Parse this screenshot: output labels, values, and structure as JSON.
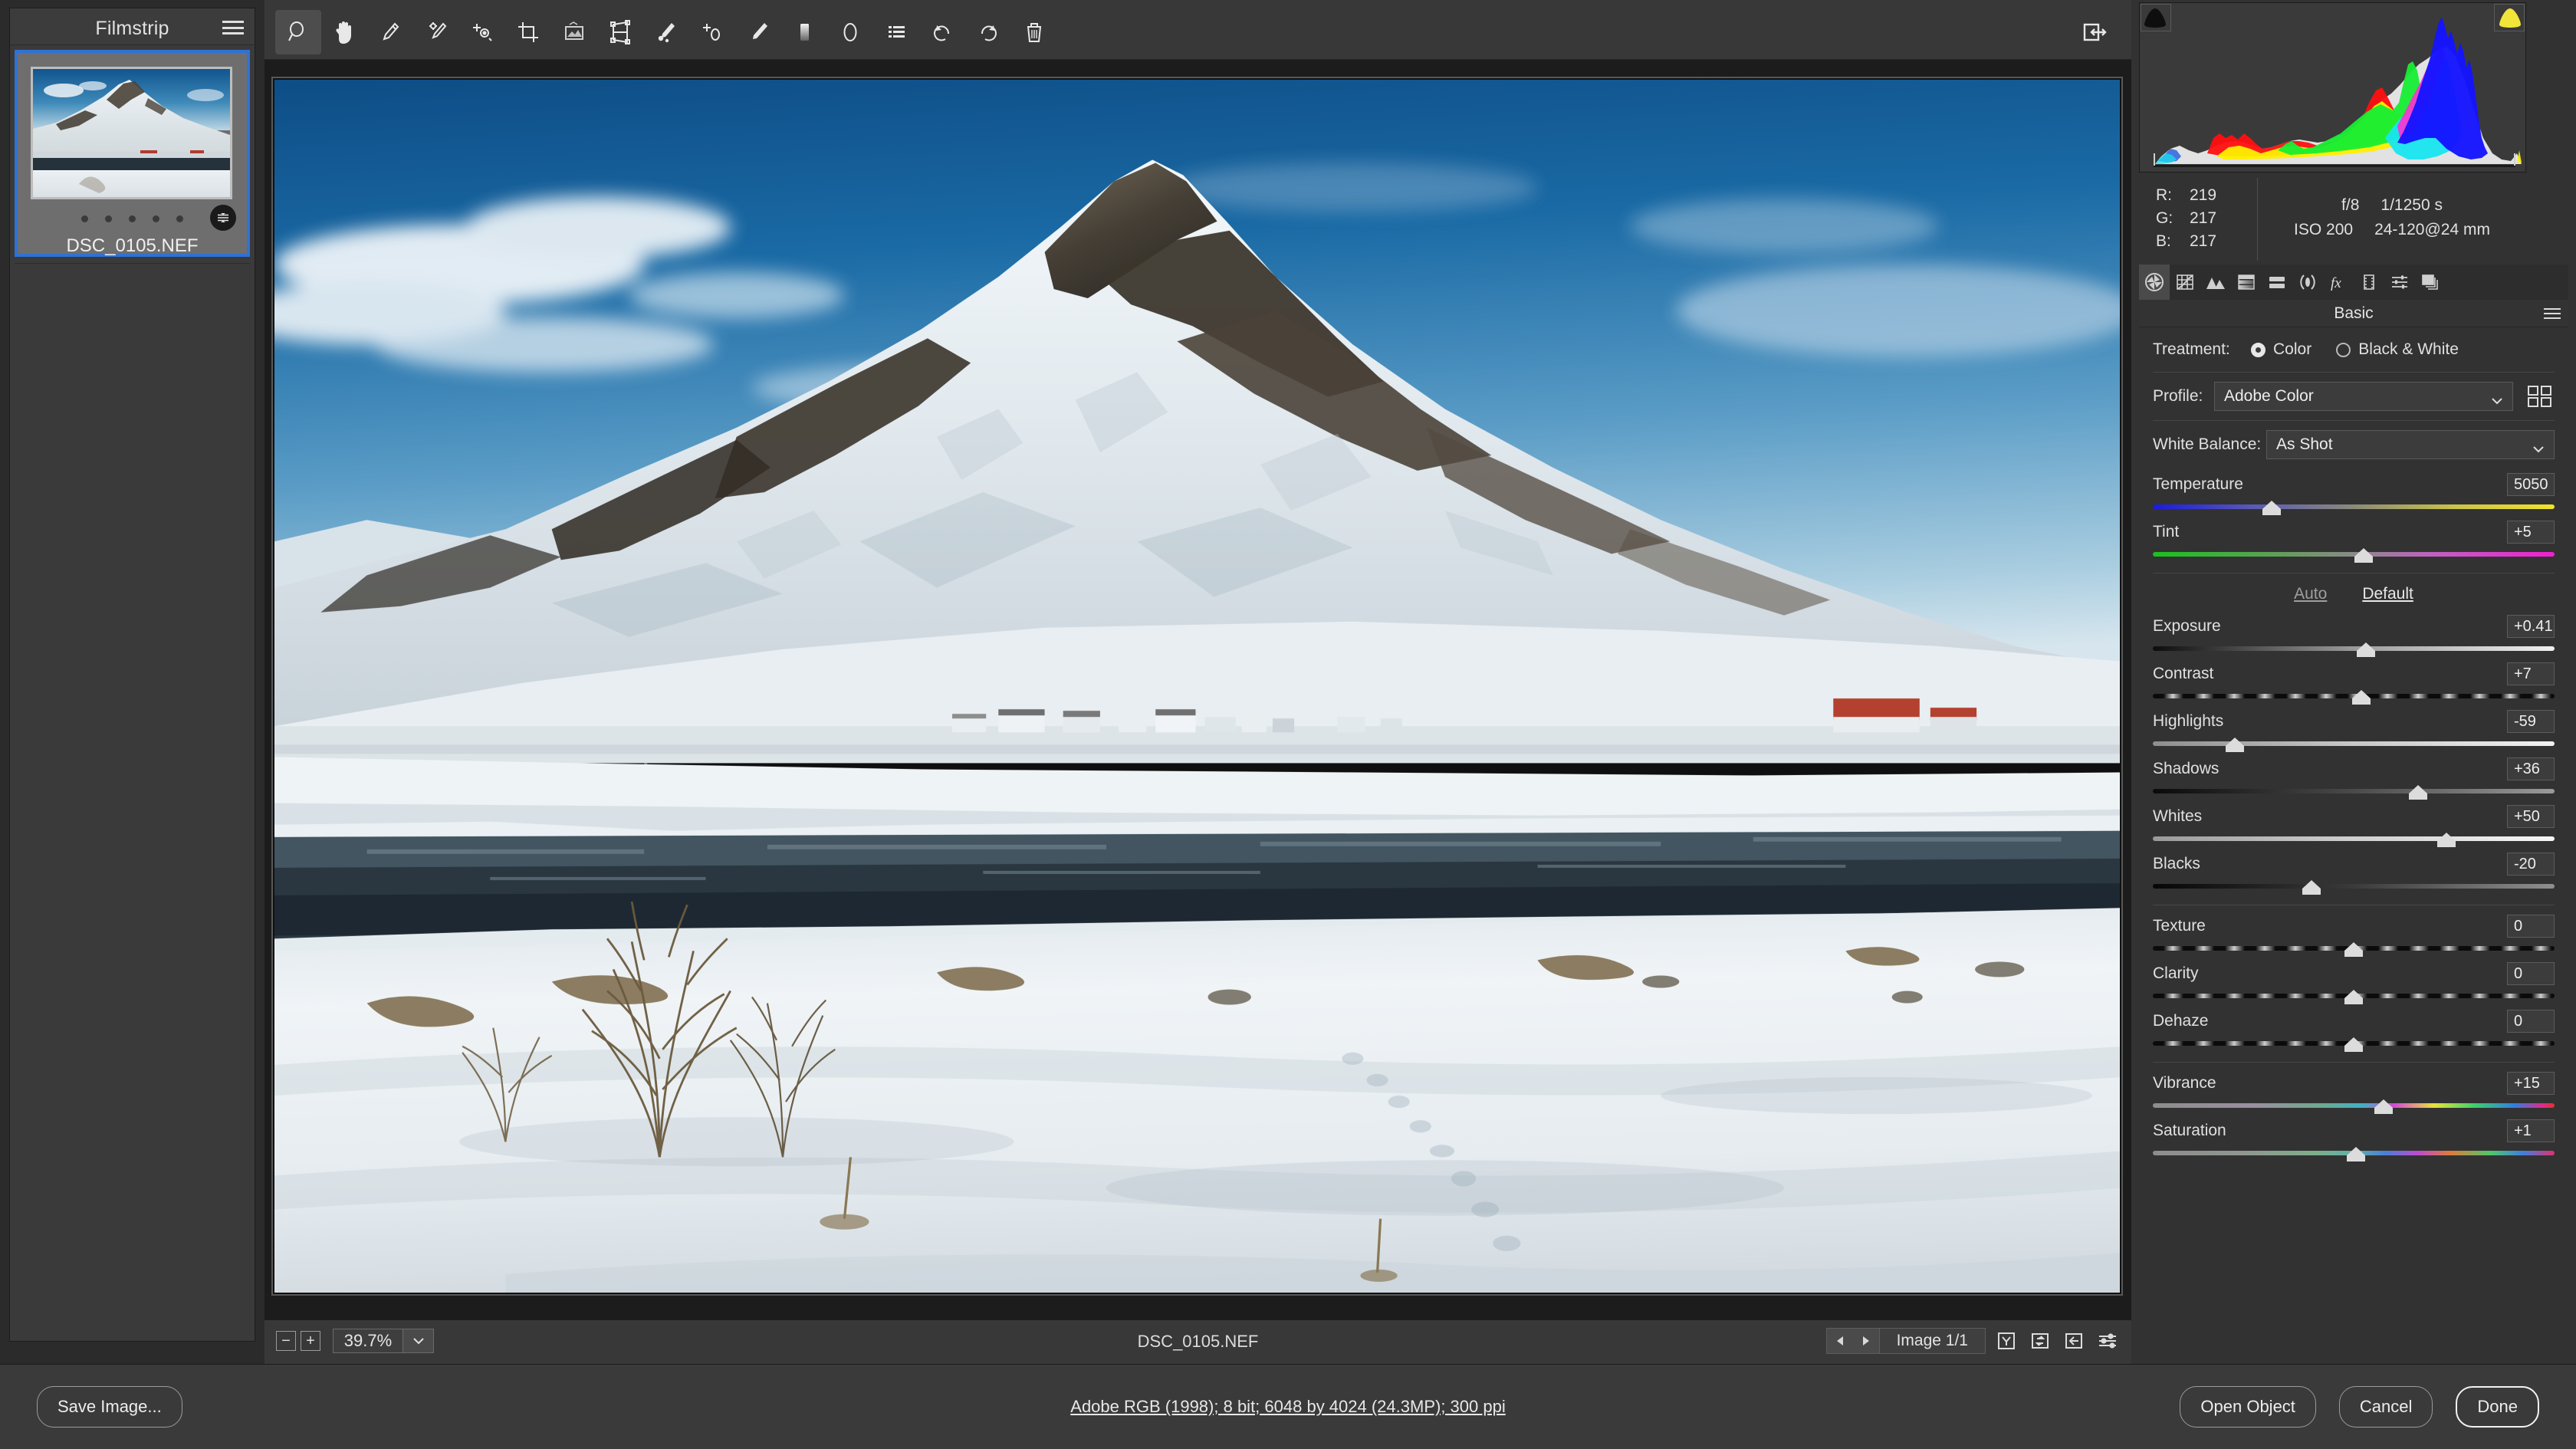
{
  "filmstrip": {
    "title": "Filmstrip",
    "menu_icon": "hamburger-icon",
    "thumbnail": {
      "filename": "DSC_0105.NEF",
      "selected": true,
      "rating_dots": 5,
      "badge_icon": "adjustments-badge-icon"
    }
  },
  "toolbar": {
    "tools": [
      {
        "name": "zoom-tool",
        "icon": "magnifier-icon",
        "active": true
      },
      {
        "name": "hand-tool",
        "icon": "hand-icon",
        "active": false
      },
      {
        "name": "white-balance-tool",
        "icon": "eyedropper-icon",
        "active": false
      },
      {
        "name": "color-sampler-tool",
        "icon": "color-sampler-icon",
        "active": false
      },
      {
        "name": "targeted-adjustment-tool",
        "icon": "target-adjust-icon",
        "active": false
      },
      {
        "name": "crop-tool",
        "icon": "crop-icon",
        "active": false
      },
      {
        "name": "straighten-tool",
        "icon": "straighten-icon",
        "active": false
      },
      {
        "name": "transform-tool",
        "icon": "transform-icon",
        "active": false
      },
      {
        "name": "spot-removal-tool",
        "icon": "spot-heal-icon",
        "active": false
      },
      {
        "name": "red-eye-tool",
        "icon": "red-eye-icon",
        "active": false
      },
      {
        "name": "adjustment-brush-tool",
        "icon": "brush-icon",
        "active": false
      },
      {
        "name": "graduated-filter-tool",
        "icon": "graduated-filter-icon",
        "active": false
      },
      {
        "name": "radial-filter-tool",
        "icon": "radial-filter-icon",
        "active": false
      },
      {
        "name": "presets-tool",
        "icon": "presets-list-icon",
        "active": false
      },
      {
        "name": "rotate-left-tool",
        "icon": "rotate-ccw-icon",
        "active": false
      },
      {
        "name": "rotate-right-tool",
        "icon": "rotate-cw-icon",
        "active": false
      },
      {
        "name": "delete-tool",
        "icon": "trash-icon",
        "active": false
      }
    ],
    "toggle_fullscreen_icon": "toggle-panel-icon"
  },
  "canvas": {
    "filename": "DSC_0105.NEF",
    "zoom": "39.7%",
    "zoom_out_label": "−",
    "zoom_in_label": "+",
    "zoom_caret_icon": "chevron-down-icon",
    "prev_icon": "triangle-left-icon",
    "next_icon": "triangle-right-icon",
    "image_count": "Image 1/1",
    "footer_icons": [
      "y-shape-icon",
      "swap-arrows-icon",
      "arrow-into-box-icon",
      "sliders-icon"
    ]
  },
  "histogram": {
    "shadow_clip_icon": "shadow-clip-triangle",
    "highlight_clip_icon": "highlight-clip-triangle",
    "highlight_clip_color": "#f2e53a",
    "shadow_clip_color": "#0e0e0e"
  },
  "readout": {
    "r_label": "R:",
    "r_value": "219",
    "g_label": "G:",
    "g_value": "217",
    "b_label": "B:",
    "b_value": "217",
    "aperture": "f/8",
    "shutter": "1/1250 s",
    "iso": "ISO 200",
    "lens": "24-120@24 mm"
  },
  "panel_tabs": [
    {
      "name": "tab-basic",
      "icon": "aperture-icon",
      "active": true
    },
    {
      "name": "tab-curve",
      "icon": "tone-curve-icon",
      "active": false
    },
    {
      "name": "tab-detail",
      "icon": "detail-triangles-icon",
      "active": false
    },
    {
      "name": "tab-color-mixer",
      "icon": "hsl-gradient-icon",
      "active": false
    },
    {
      "name": "tab-color-grading",
      "icon": "split-tone-icon",
      "active": false
    },
    {
      "name": "tab-optics",
      "icon": "lens-optics-icon",
      "active": false
    },
    {
      "name": "tab-effects",
      "icon": "fx-icon",
      "active": false
    },
    {
      "name": "tab-calibration",
      "icon": "filmstrip-calibration-icon",
      "active": false
    },
    {
      "name": "tab-presets",
      "icon": "sliders-presets-icon",
      "active": false
    },
    {
      "name": "tab-snapshots",
      "icon": "snapshots-stack-icon",
      "active": false
    }
  ],
  "basic_panel": {
    "title": "Basic",
    "menu_icon": "panel-menu-icon",
    "treatment_label": "Treatment:",
    "treatment_options": [
      {
        "label": "Color",
        "selected": true
      },
      {
        "label": "Black & White",
        "selected": false
      }
    ],
    "profile_label": "Profile:",
    "profile_value": "Adobe Color",
    "profile_browse_icon": "profile-grid-icon",
    "white_balance_label": "White Balance:",
    "white_balance_value": "As Shot",
    "auto_label": "Auto",
    "default_label": "Default",
    "wb_sliders": [
      {
        "name": "temperature",
        "label": "Temperature",
        "value": "5050",
        "pos": 29.5,
        "track": "temp"
      },
      {
        "name": "tint",
        "label": "Tint",
        "value": "+5",
        "pos": 52.5,
        "track": "tint"
      }
    ],
    "tone_sliders": [
      {
        "name": "exposure",
        "label": "Exposure",
        "value": "+0.41",
        "pos": 53.0,
        "track": "exposure"
      },
      {
        "name": "contrast",
        "label": "Contrast",
        "value": "+7",
        "pos": 52.0,
        "track": "contrast"
      },
      {
        "name": "highlights",
        "label": "Highlights",
        "value": "-59",
        "pos": 20.5,
        "track": "highlights"
      },
      {
        "name": "shadows",
        "label": "Shadows",
        "value": "+36",
        "pos": 66.0,
        "track": "shadows"
      },
      {
        "name": "whites",
        "label": "Whites",
        "value": "+50",
        "pos": 73.0,
        "track": "whites"
      },
      {
        "name": "blacks",
        "label": "Blacks",
        "value": "-20",
        "pos": 39.5,
        "track": "blacks"
      }
    ],
    "presence_sliders": [
      {
        "name": "texture",
        "label": "Texture",
        "value": "0",
        "pos": 50.0,
        "track": "contrast"
      },
      {
        "name": "clarity",
        "label": "Clarity",
        "value": "0",
        "pos": 50.0,
        "track": "contrast"
      },
      {
        "name": "dehaze",
        "label": "Dehaze",
        "value": "0",
        "pos": 50.0,
        "track": "contrast"
      }
    ],
    "color_sliders": [
      {
        "name": "vibrance",
        "label": "Vibrance",
        "value": "+15",
        "pos": 57.5,
        "track": "vibrance"
      },
      {
        "name": "saturation",
        "label": "Saturation",
        "value": "+1",
        "pos": 50.5,
        "track": "vibrance"
      }
    ]
  },
  "bottom_bar": {
    "save_label": "Save Image...",
    "info_link": "Adobe RGB (1998); 8 bit; 6048 by 4024 (24.3MP); 300 ppi",
    "open_object_label": "Open Object",
    "cancel_label": "Cancel",
    "done_label": "Done"
  },
  "colors": {
    "accent_selection": "#2f72d6",
    "panel_bg": "#323232",
    "canvas_bg": "#1c1c1c",
    "toolbar_bg": "#383838"
  }
}
